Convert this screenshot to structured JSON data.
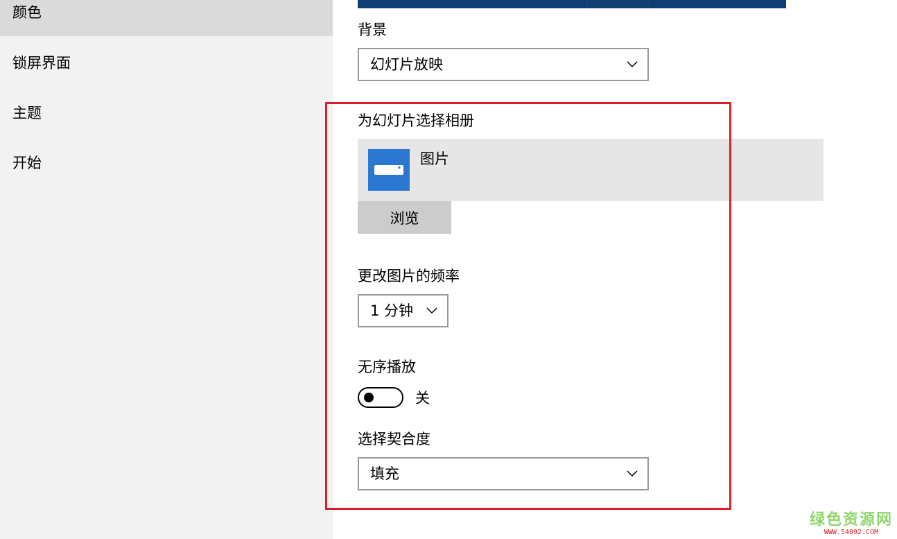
{
  "sidebar": {
    "items": [
      {
        "label": "颜色",
        "selected": true
      },
      {
        "label": "锁屏界面",
        "selected": false
      },
      {
        "label": "主题",
        "selected": false
      },
      {
        "label": "开始",
        "selected": false
      }
    ]
  },
  "background": {
    "label": "背景",
    "selected": "幻灯片放映"
  },
  "album": {
    "label": "为幻灯片选择相册",
    "item_label": "图片",
    "icon": "photos-folder-icon",
    "browse_label": "浏览"
  },
  "frequency": {
    "label": "更改图片的频率",
    "selected": "1 分钟"
  },
  "shuffle": {
    "label": "无序播放",
    "state_label": "关",
    "on": false
  },
  "fit": {
    "label": "选择契合度",
    "selected": "填充"
  },
  "watermark": {
    "title": "绿色资源网",
    "url": "WWW.54092.COM"
  },
  "colors": {
    "accent": "#2b78d0",
    "highlight": "#d8202a",
    "sidebar_bg": "#f2f2f2",
    "sidebar_selected": "#dadada",
    "album_bg": "#e6e6e6",
    "button_bg": "#cccccc"
  }
}
